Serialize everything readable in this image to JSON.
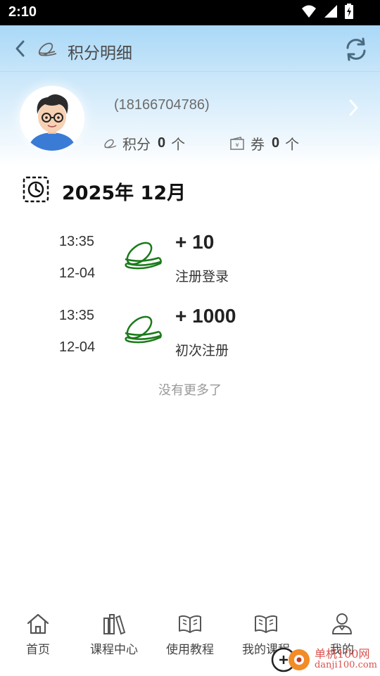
{
  "status_bar": {
    "time": "2:10"
  },
  "nav": {
    "title": "积分明细",
    "back_icon": "chevron-left-icon",
    "refresh_icon": "refresh-icon"
  },
  "profile": {
    "phone": "(18166704786)",
    "points_label": "积分",
    "points_value": "0",
    "points_unit": "个",
    "coupon_label": "券",
    "coupon_value": "0",
    "coupon_unit": "个"
  },
  "month": {
    "title": "2025年 12月"
  },
  "records": [
    {
      "time": "13:35",
      "date": "12-04",
      "amount": "+ 10",
      "desc": "注册登录"
    },
    {
      "time": "13:35",
      "date": "12-04",
      "amount": "+ 1000",
      "desc": "初次注册"
    }
  ],
  "footer_note": "没有更多了",
  "tabs": [
    {
      "label": "首页",
      "icon": "home-icon"
    },
    {
      "label": "课程中心",
      "icon": "books-icon"
    },
    {
      "label": "使用教程",
      "icon": "open-book-icon"
    },
    {
      "label": "我的课程",
      "icon": "open-book-icon"
    },
    {
      "label": "我的",
      "icon": "user-icon"
    }
  ],
  "watermark": {
    "line1": "单机100网",
    "line2": "danji100.com"
  },
  "colors": {
    "accent_green": "#1a7a1a",
    "header_blue": "#a9d8f7",
    "nav_icon": "#4a6a80"
  }
}
